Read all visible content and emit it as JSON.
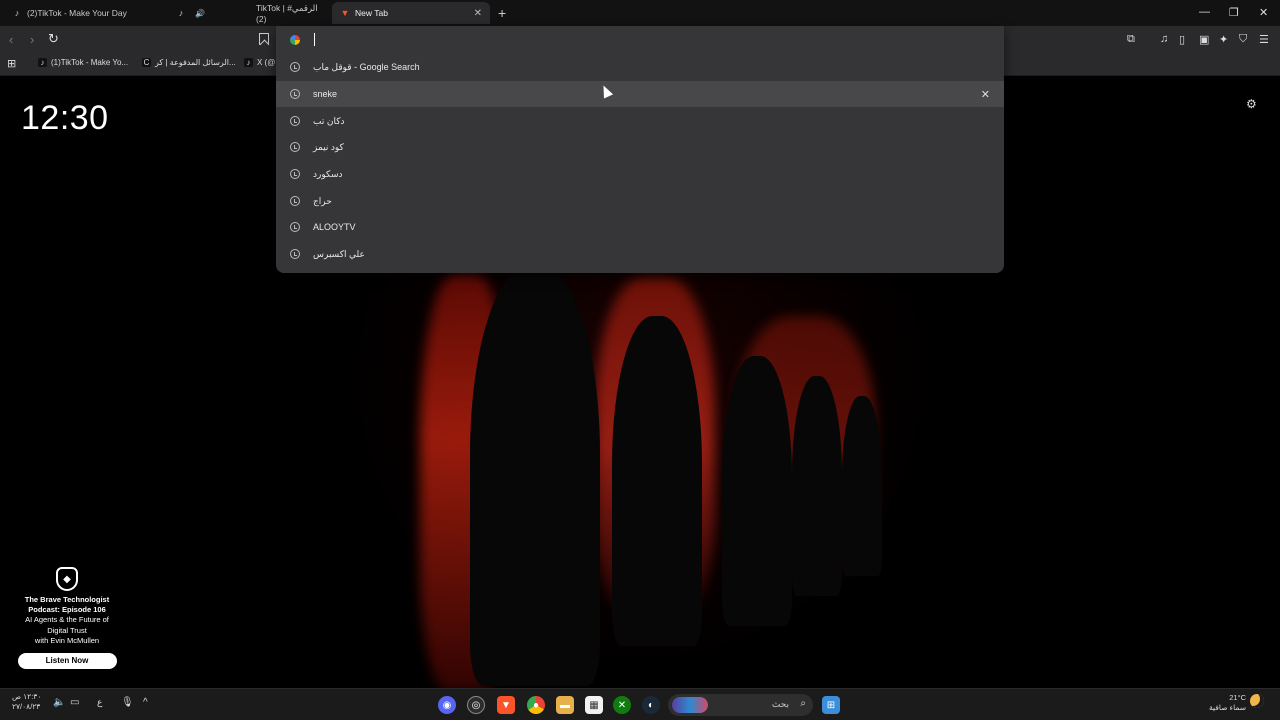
{
  "tabs": [
    {
      "label": "(2)TikTok - Make Your Day",
      "icon": "tiktok-icon"
    },
    {
      "label": "TikTok | الرقمي#(2)",
      "icon": "tiktok-icon",
      "audio": true
    },
    {
      "label": "New Tab",
      "icon": "brave-icon",
      "active": true
    }
  ],
  "bookmarks": [
    {
      "label": "(1)TikTok - Make Yo...",
      "icon": "tiktok-icon"
    },
    {
      "label": "الرسائل المدفوعة | كر...",
      "icon": "c-icon"
    },
    {
      "label": "X (@",
      "icon": "tiktok-icon"
    }
  ],
  "omnibox": {
    "value": "",
    "suggestions": [
      {
        "label": "قوقل ماب - Google Search",
        "icon": "history-icon"
      },
      {
        "label": "sneke",
        "icon": "history-icon",
        "highlighted": true
      },
      {
        "label": "دكان تب",
        "icon": "history-icon"
      },
      {
        "label": "كود نيمز",
        "icon": "history-icon"
      },
      {
        "label": "دسكورد",
        "icon": "history-icon"
      },
      {
        "label": "حراج",
        "icon": "history-icon"
      },
      {
        "label": "ALOOYTV",
        "icon": "history-icon"
      },
      {
        "label": "علي اكسبرس",
        "icon": "history-icon"
      }
    ]
  },
  "clock": "12:30",
  "promo": {
    "title": "The Brave Technologist Podcast: Episode 106",
    "subtitle_lines": [
      "AI Agents & the Future of",
      "Digital Trust",
      "with Evin McMullen"
    ],
    "button": "Listen Now"
  },
  "taskbar": {
    "search_text": "بحث",
    "time": "١٢:٣٠ ص",
    "date": "٢٧/٠٨/٢٣",
    "keyboard_lang": "ع",
    "weather_temp": "21°C",
    "weather_desc": "سماء صافية"
  },
  "colors": {
    "accent": "#fb542b",
    "omnibox_bg": "#363638",
    "highlight": "#48484b"
  }
}
